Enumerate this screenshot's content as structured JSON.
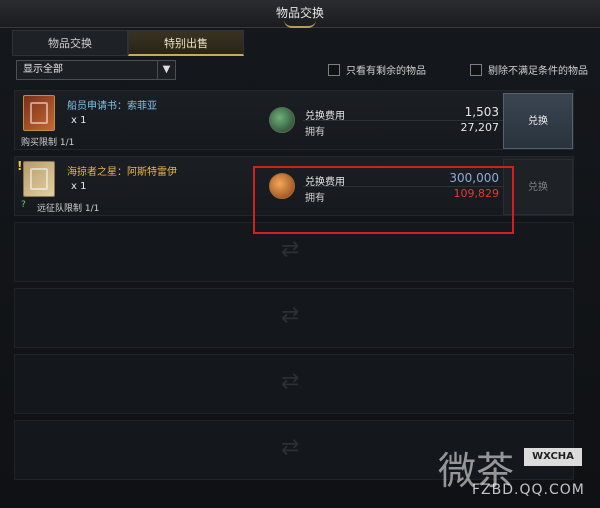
{
  "window": {
    "title": "物品交换"
  },
  "tabs": [
    {
      "label": "物品交换",
      "active": false
    },
    {
      "label": "特别出售",
      "active": true
    }
  ],
  "filter": {
    "select_value": "显示全部",
    "checkbox_remaining": "只看有剩余的物品",
    "checkbox_exclude": "剔除不满足条件的物品"
  },
  "rows": [
    {
      "icon": "red-scroll-icon",
      "name": "船员申请书：索菲亚",
      "qty": "x 1",
      "limit": "购买限制 1/1",
      "cost_label": "兑换费用",
      "cost_value": "1,503",
      "own_label": "拥有",
      "own_value": "27,207",
      "button": "兑换",
      "currency_icon": "green-gem-icon"
    },
    {
      "icon": "map-scroll-icon",
      "name": "海掠者之星：阿斯特雷伊",
      "qty": "x 1",
      "limit": "远征队限制 1/1",
      "cost_label": "兑换费用",
      "cost_value": "300,000",
      "own_label": "拥有",
      "own_value": "109,829",
      "button": "兑换",
      "currency_icon": "orange-coin-icon"
    }
  ],
  "watermark": {
    "cn": "微茶",
    "badge": "WXCHA",
    "url": "FZBD.QQ.COM"
  },
  "colors": {
    "accent_gold": "#c9a862",
    "name_blue": "#7fc1e6",
    "name_gold": "#e7b54b",
    "insufficient_red": "#e03a3a",
    "highlight_red": "#d02020"
  }
}
